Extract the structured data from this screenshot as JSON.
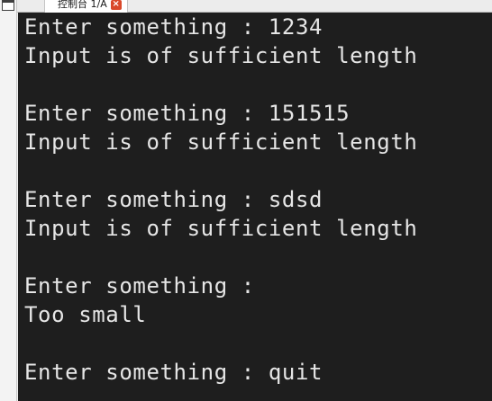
{
  "tab": {
    "title": "控制台 1/A",
    "close_glyph": "×"
  },
  "console": {
    "lines": [
      "Enter something : 1234",
      "Input is of sufficient length",
      "",
      "Enter something : 151515",
      "Input is of sufficient length",
      "",
      "Enter something : sdsd",
      "Input is of sufficient length",
      "",
      "Enter something :",
      "Too small",
      "",
      "Enter something : quit"
    ]
  },
  "colors": {
    "console_background": "#1e1e1e",
    "console_text": "#e6e6e6",
    "tab_close": "#d9482a"
  }
}
